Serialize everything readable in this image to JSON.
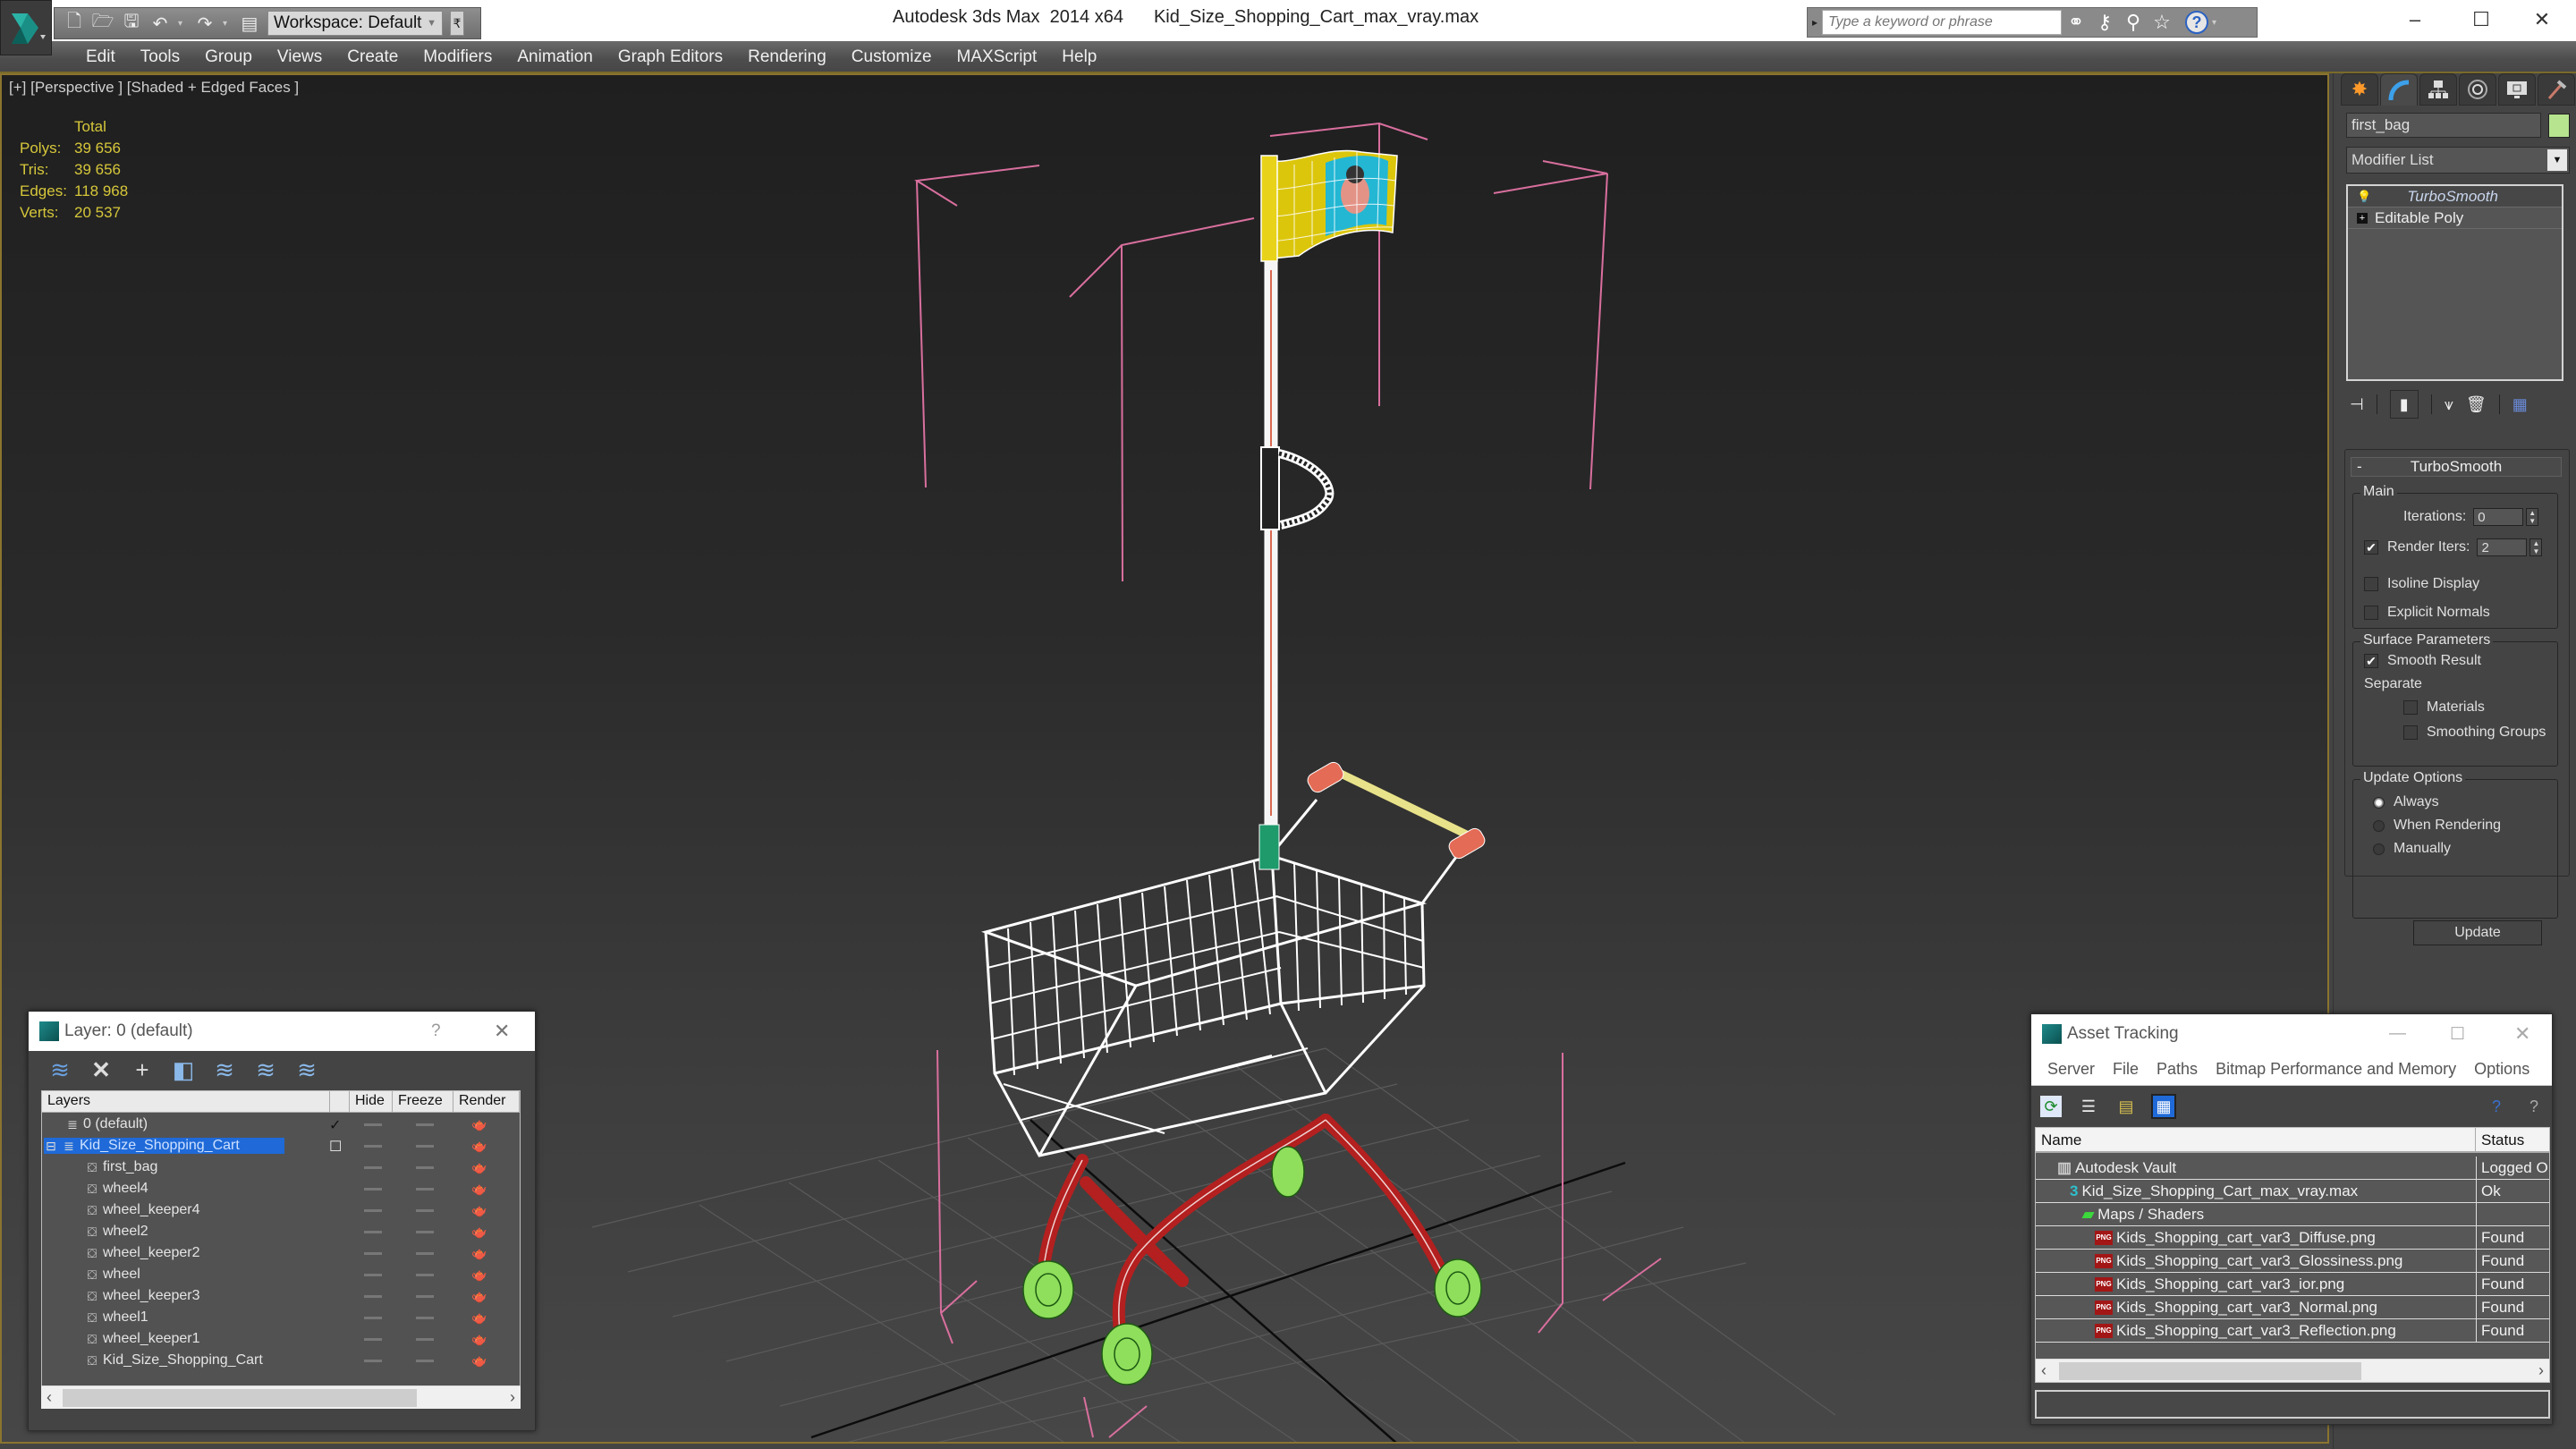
{
  "app": {
    "title": "Autodesk 3ds Max  2014 x64",
    "file_name": "Kid_Size_Shopping_Cart_max_vray.max",
    "workspace": "Workspace: Default",
    "search_placeholder": "Type a keyword or phrase",
    "window_controls": {
      "minimize": "–",
      "maximize": "☐",
      "close": "✕"
    },
    "help_label": "?"
  },
  "menu": [
    "Edit",
    "Tools",
    "Group",
    "Views",
    "Create",
    "Modifiers",
    "Animation",
    "Graph Editors",
    "Rendering",
    "Customize",
    "MAXScript",
    "Help"
  ],
  "viewport": {
    "label": "[+] [Perspective ] [Shaded + Edged Faces ]",
    "stats": {
      "header": "Total",
      "rows": [
        {
          "label": "Polys:",
          "value": "39 656"
        },
        {
          "label": "Tris:",
          "value": "39 656"
        },
        {
          "label": "Edges:",
          "value": "118 968"
        },
        {
          "label": "Verts:",
          "value": "20 537"
        }
      ]
    }
  },
  "command_panel": {
    "tabs": [
      "create-icon",
      "modify-icon",
      "hierarchy-icon",
      "motion-icon",
      "display-icon",
      "utilities-icon"
    ],
    "active_tab": 1,
    "object_name": "first_bag",
    "object_color": "#b7e48f",
    "modifier_list_label": "Modifier List",
    "stack": [
      {
        "label": "TurboSmooth",
        "active": true
      },
      {
        "label": "Editable Poly",
        "active": false
      }
    ],
    "rollout": {
      "title": "TurboSmooth",
      "collapse": "-",
      "main_group": "Main",
      "iterations_label": "Iterations:",
      "iterations_value": "0",
      "render_iters_label": "Render Iters:",
      "render_iters_value": "2",
      "render_iters_checked": true,
      "isoline_display": {
        "label": "Isoline Display",
        "checked": false
      },
      "explicit_normals": {
        "label": "Explicit Normals",
        "checked": false
      },
      "surface_group": "Surface Parameters",
      "smooth_result": {
        "label": "Smooth Result",
        "checked": true
      },
      "separate_label": "Separate",
      "materials": {
        "label": "Materials",
        "checked": false
      },
      "smoothing_groups": {
        "label": "Smoothing Groups",
        "checked": false
      },
      "update_group": "Update Options",
      "update_options": [
        {
          "label": "Always",
          "selected": true
        },
        {
          "label": "When Rendering",
          "selected": false
        },
        {
          "label": "Manually",
          "selected": false
        }
      ],
      "update_button": "Update"
    }
  },
  "layer_dialog": {
    "title": "Layer: 0 (default)",
    "help": "?",
    "close": "✕",
    "columns": [
      "Layers",
      "",
      "Hide",
      "Freeze",
      "Render"
    ],
    "rows": [
      {
        "name": "0 (default)",
        "type": "layer",
        "indent": 1,
        "current": true,
        "selected": false
      },
      {
        "name": "Kid_Size_Shopping_Cart",
        "type": "layer",
        "indent": 0,
        "current": false,
        "selected": true,
        "expanded": true
      },
      {
        "name": "first_bag",
        "type": "object",
        "indent": 2
      },
      {
        "name": "wheel4",
        "type": "object",
        "indent": 2
      },
      {
        "name": "wheel_keeper4",
        "type": "object",
        "indent": 2
      },
      {
        "name": "wheel2",
        "type": "object",
        "indent": 2
      },
      {
        "name": "wheel_keeper2",
        "type": "object",
        "indent": 2
      },
      {
        "name": "wheel",
        "type": "object",
        "indent": 2
      },
      {
        "name": "wheel_keeper3",
        "type": "object",
        "indent": 2
      },
      {
        "name": "wheel1",
        "type": "object",
        "indent": 2
      },
      {
        "name": "wheel_keeper1",
        "type": "object",
        "indent": 2
      },
      {
        "name": "Kid_Size_Shopping_Cart",
        "type": "object",
        "indent": 2
      }
    ]
  },
  "asset_dialog": {
    "title": "Asset Tracking",
    "menu": [
      "Server",
      "File",
      "Paths",
      "Bitmap Performance and Memory",
      "Options"
    ],
    "columns": [
      "Name",
      "Status"
    ],
    "rows": [
      {
        "name": "Autodesk Vault",
        "status": "Logged O",
        "icon": "vault-icon",
        "indent": 1
      },
      {
        "name": "Kid_Size_Shopping_Cart_max_vray.max",
        "status": "Ok",
        "icon": "max-file-icon",
        "indent": 2
      },
      {
        "name": "Maps / Shaders",
        "status": "",
        "icon": "maps-icon",
        "indent": 3
      },
      {
        "name": "Kids_Shopping_cart_var3_Diffuse.png",
        "status": "Found",
        "icon": "png-icon",
        "indent": 4
      },
      {
        "name": "Kids_Shopping_cart_var3_Glossiness.png",
        "status": "Found",
        "icon": "png-icon",
        "indent": 4
      },
      {
        "name": "Kids_Shopping_cart_var3_ior.png",
        "status": "Found",
        "icon": "png-icon",
        "indent": 4
      },
      {
        "name": "Kids_Shopping_cart_var3_Normal.png",
        "status": "Found",
        "icon": "png-icon",
        "indent": 4
      },
      {
        "name": "Kids_Shopping_cart_var3_Reflection.png",
        "status": "Found",
        "icon": "png-icon",
        "indent": 4
      }
    ],
    "png_label": "PNG"
  }
}
